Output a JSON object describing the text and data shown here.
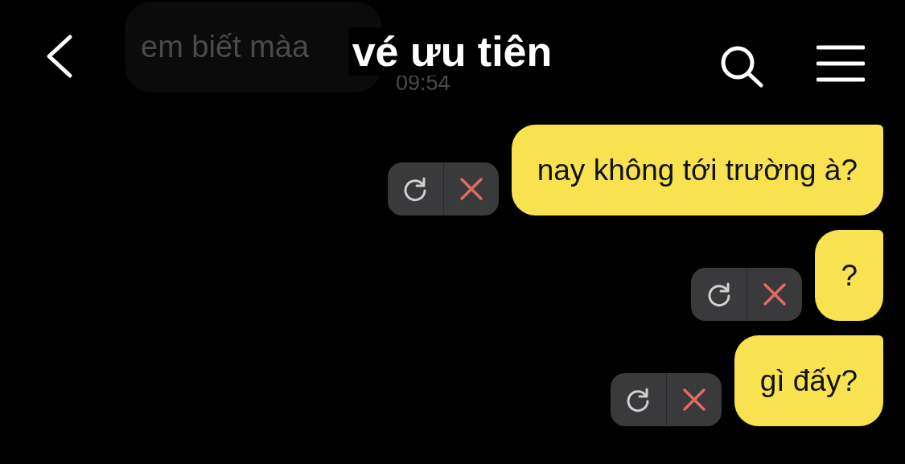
{
  "header": {
    "title": "vé ưu tiên"
  },
  "faded_message": {
    "text": "em biết màa",
    "time": "09:54"
  },
  "messages": [
    {
      "text": "nay không tới trường à?",
      "failed": true
    },
    {
      "text": "?",
      "failed": true
    },
    {
      "text": "gì đấy?",
      "failed": true
    }
  ]
}
